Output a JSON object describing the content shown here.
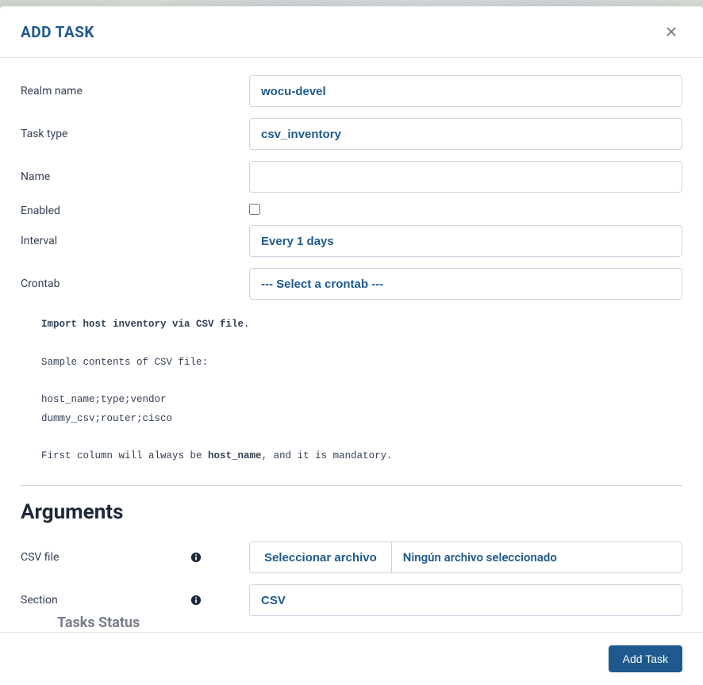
{
  "modal": {
    "title": "ADD TASK",
    "footer": {
      "submit_label": "Add Task"
    }
  },
  "form": {
    "realm_name": {
      "label": "Realm name",
      "value": "wocu-devel"
    },
    "task_type": {
      "label": "Task type",
      "value": "csv_inventory"
    },
    "name": {
      "label": "Name",
      "value": ""
    },
    "enabled": {
      "label": "Enabled",
      "checked": false
    },
    "interval": {
      "label": "Interval",
      "value": "Every 1 days"
    },
    "crontab": {
      "label": "Crontab",
      "value": "--- Select a crontab ---"
    }
  },
  "description": {
    "line1_bold": "Import host inventory via CSV file",
    "line1_suffix": ".",
    "line2": "Sample contents of CSV file:",
    "line3": "host_name;type;vendor",
    "line4": "dummy_csv;router;cisco",
    "line5_prefix": "First column will always be ",
    "line5_bold": "host_name",
    "line5_suffix": ", and it is mandatory."
  },
  "arguments": {
    "heading": "Arguments",
    "csv_file": {
      "label": "CSV file",
      "button": "Seleccionar archivo",
      "status": "Ningún archivo seleccionado"
    },
    "section": {
      "label": "Section",
      "value": "CSV"
    }
  },
  "background": {
    "partial_text": "Tasks Status"
  }
}
